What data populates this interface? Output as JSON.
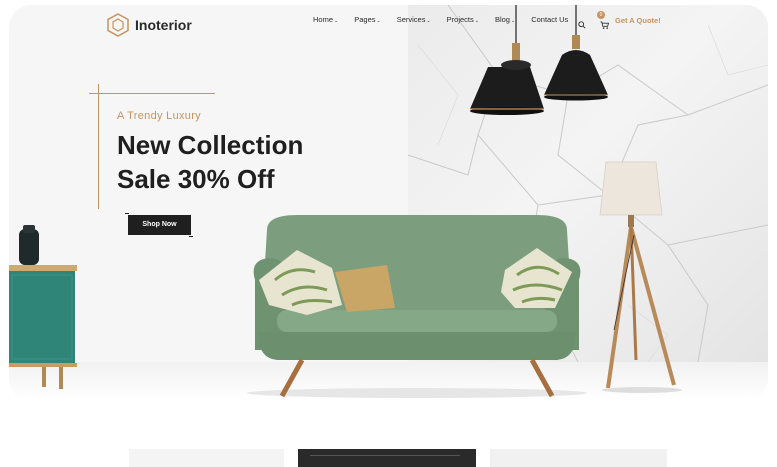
{
  "brand": {
    "name": "Inoterior"
  },
  "nav": {
    "items": [
      {
        "label": "Home",
        "has_dropdown": true
      },
      {
        "label": "Pages",
        "has_dropdown": true
      },
      {
        "label": "Services",
        "has_dropdown": true
      },
      {
        "label": "Projects",
        "has_dropdown": true
      },
      {
        "label": "Blog",
        "has_dropdown": true
      },
      {
        "label": "Contact Us",
        "has_dropdown": false
      }
    ],
    "search_icon": "search-icon",
    "cart_icon": "cart-icon",
    "cart_count": "0",
    "cta_label": "Get A Quote!"
  },
  "hero": {
    "subtitle": "A Trendy Luxury",
    "title_line1": "New Collection",
    "title_line2": "Sale 30% Off",
    "button_label": "Shop Now"
  },
  "colors": {
    "accent": "#c6945f",
    "dark": "#1f1f1f",
    "sofa_green": "#7fa07f",
    "cabinet_teal": "#2f8577"
  }
}
